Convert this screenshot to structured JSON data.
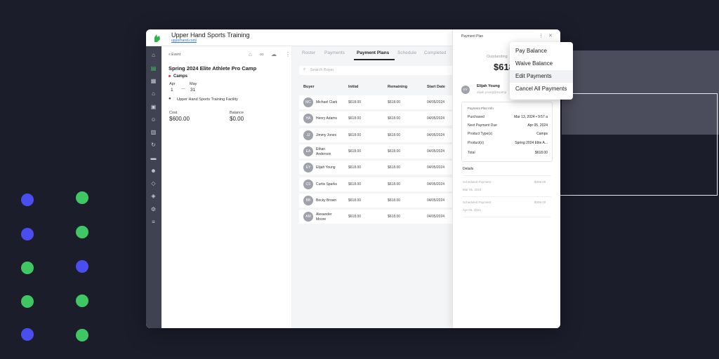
{
  "app": {
    "title": "Upper Hand Sports Training",
    "url": "upperhand.com/"
  },
  "event": {
    "back_label": "< Event",
    "title": "Spring 2024 Elite Athlete Pro Camp",
    "type": "Camps",
    "start_month": "Apr",
    "start_day": "1",
    "separator": "—",
    "end_month": "May",
    "end_day": "31",
    "facility": "Upper Hand Sports Training Facility",
    "cost_label": "Cost",
    "cost_value": "$600.00",
    "balance_label": "Balance",
    "balance_value": "$0.00"
  },
  "tabs": [
    "Roster",
    "Payments",
    "Payment Plans",
    "Schedule",
    "Completed"
  ],
  "active_tab": "Payment Plans",
  "search": {
    "placeholder": "Search Buyer"
  },
  "table": {
    "columns": [
      "Buyer",
      "Initial",
      "Remaining",
      "Start Date"
    ],
    "rows": [
      {
        "initials": "MC",
        "name": "Michael Clark",
        "name2": "",
        "initial": "$618.00",
        "remaining": "$618.00",
        "start": "04/05/2024"
      },
      {
        "initials": "HA",
        "name": "Henry Adams",
        "name2": "",
        "initial": "$618.00",
        "remaining": "$618.00",
        "start": "04/05/2024"
      },
      {
        "initials": "JJ",
        "name": "Jimmy Jones",
        "name2": "",
        "initial": "$618.00",
        "remaining": "$618.00",
        "start": "04/05/2024"
      },
      {
        "initials": "EA",
        "name": "Ethan",
        "name2": "Anderson",
        "initial": "$618.00",
        "remaining": "$618.00",
        "start": "04/05/2024"
      },
      {
        "initials": "EY",
        "name": "Elijah Young",
        "name2": "",
        "initial": "$618.00",
        "remaining": "$618.00",
        "start": "04/05/2024"
      },
      {
        "initials": "CS",
        "name": "Curtis Sparks",
        "name2": "",
        "initial": "$618.00",
        "remaining": "$618.00",
        "start": "04/05/2024"
      },
      {
        "initials": "BB",
        "name": "Becky Brown",
        "name2": "",
        "initial": "$618.00",
        "remaining": "$618.00",
        "start": "04/05/2024"
      },
      {
        "initials": "AM",
        "name": "Alexander",
        "name2": "Moore",
        "initial": "$618.00",
        "remaining": "$618.00",
        "start": "04/05/2024"
      }
    ]
  },
  "drawer": {
    "title": "Payment Plan",
    "outstanding_label": "Outstanding",
    "outstanding_value": "$618",
    "customer_initials": "EY",
    "customer_name": "Elijah Young",
    "customer_email": "elijah.young@examp",
    "info_title": "Payment Plan Info",
    "info": [
      {
        "label": "Purchased",
        "value": "Mar 13, 2024 • 9:57 a"
      },
      {
        "label": "Next Payment Due",
        "value": "Apr 05, 2024"
      },
      {
        "label": "Product Type(s)",
        "value": "Camps"
      },
      {
        "label": "Product(s)",
        "value": "Spring 2024 Elite A..."
      },
      {
        "label": "Total",
        "value": "$618.00"
      }
    ],
    "details_label": "Details",
    "schedule": [
      {
        "label": "Scheduled Payment",
        "amount": "$309.00",
        "date": "Mar 05, 2024"
      },
      {
        "label": "Scheduled Payment",
        "amount": "$309.00",
        "date": "Apr 05, 2024"
      }
    ]
  },
  "menu": {
    "items": [
      "Pay Balance",
      "Waive Balance",
      "Edit Payments",
      "Cancel All Payments"
    ],
    "highlighted": "Edit Payments"
  },
  "colors": {
    "background": "#1b1d2b",
    "dot_blue": "#4a4ef0",
    "dot_green": "#3fc764",
    "sidebar": "#3f4250",
    "accent_green": "#2fb24c"
  }
}
